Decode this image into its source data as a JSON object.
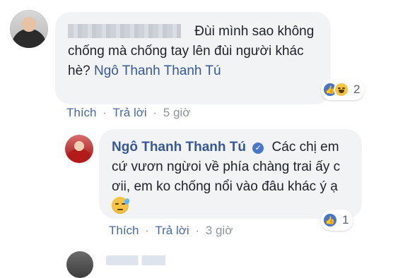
{
  "comments": [
    {
      "text_before_mention": "Đùi mình sao không chống mà chống tay lên đùi người khác hè?",
      "mention": "Ngô Thanh Thanh Tú",
      "reactions": {
        "icons": [
          "like-icon",
          "haha-icon"
        ],
        "count": "2"
      },
      "actions": {
        "like": "Thích",
        "reply": "Trả lời",
        "time": "5 giờ"
      }
    }
  ],
  "reply": {
    "author": "Ngô Thanh Thanh Tú",
    "verified": true,
    "text": "Các chị em cứ vươn ngừoi về phía chàng trai ấy c ơii, em ko chống nổi vào đâu khác ý ạ",
    "emoji": "sweat-smile-emoji-icon",
    "reactions": {
      "icons": [
        "like-icon"
      ],
      "count": "1"
    },
    "actions": {
      "like": "Thích",
      "reply": "Trả lời",
      "time": "3 giờ"
    }
  },
  "colors": {
    "link": "#365899",
    "bubble": "#f2f3f5",
    "meta": "#90949c",
    "like_blue": "#4a76c9"
  }
}
